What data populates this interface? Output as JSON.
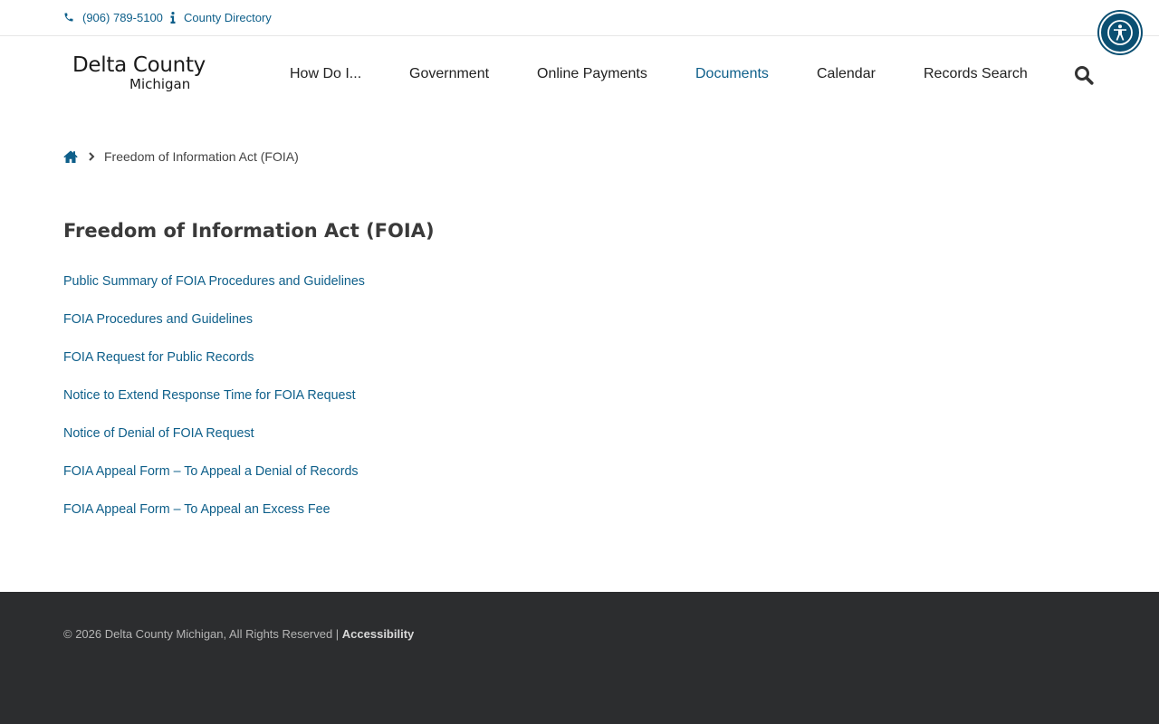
{
  "topbar": {
    "phone": "(906) 789-5100",
    "directory": "County Directory"
  },
  "logo": {
    "line1": "Delta County",
    "line2": "Michigan"
  },
  "nav": {
    "items": [
      {
        "label": "How Do I..."
      },
      {
        "label": "Government"
      },
      {
        "label": "Online Payments"
      },
      {
        "label": "Documents",
        "active": true
      },
      {
        "label": "Calendar"
      },
      {
        "label": "Records Search"
      }
    ]
  },
  "breadcrumb": {
    "current": "Freedom of Information Act (FOIA)"
  },
  "page": {
    "title": "Freedom of Information Act (FOIA)",
    "links": [
      "Public Summary of FOIA Procedures and Guidelines",
      "FOIA Procedures and Guidelines",
      "FOIA Request for Public Records",
      "Notice to Extend Response Time for FOIA Request",
      "Notice of Denial of FOIA Request",
      "FOIA Appeal Form – To Appeal a Denial of Records",
      "FOIA Appeal Form – To Appeal an Excess Fee"
    ]
  },
  "footer": {
    "copyright": "© 2026 Delta County Michigan, All Rights Reserved | ",
    "accessibility_link": "Accessibility"
  },
  "icons": {
    "phone": "phone-icon",
    "info": "info-icon",
    "accessibility": "accessibility-icon",
    "search": "search-icon",
    "home": "home-icon",
    "separator": "chevron-right-icon"
  },
  "colors": {
    "link": "#0e5f8a",
    "accessibility_button": "#0b4f72",
    "footer_bg": "#2c2d2f"
  }
}
